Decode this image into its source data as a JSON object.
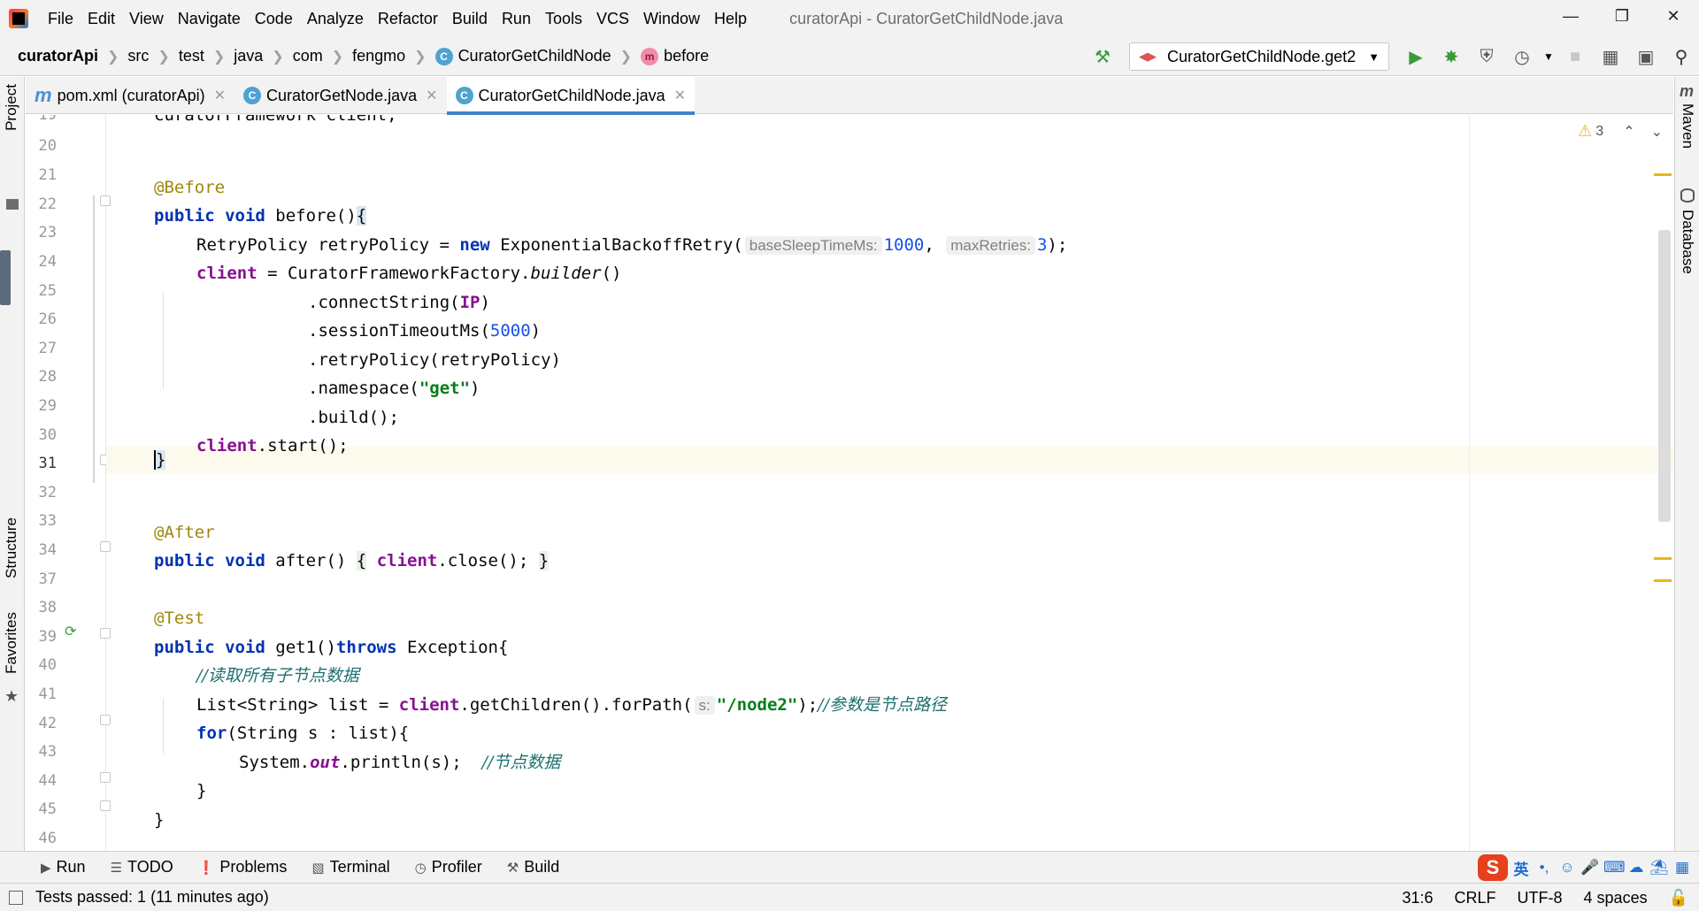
{
  "menubar": {
    "items": [
      "File",
      "Edit",
      "View",
      "Navigate",
      "Code",
      "Analyze",
      "Refactor",
      "Build",
      "Run",
      "Tools",
      "VCS",
      "Window",
      "Help"
    ],
    "window_title": "curatorApi - CuratorGetChildNode.java"
  },
  "navbar": {
    "project": "curatorApi",
    "crumbs": [
      "src",
      "test",
      "java",
      "com",
      "fengmo"
    ],
    "class_crumb": "CuratorGetChildNode",
    "method_crumb": "before",
    "run_config": "CuratorGetChildNode.get2"
  },
  "left_strip": {
    "project": "Project",
    "structure": "Structure",
    "favorites": "Favorites"
  },
  "right_strip": {
    "maven": "Maven",
    "database": "Database"
  },
  "tabs": [
    {
      "label": "pom.xml (curatorApi)",
      "icon": "maven-icon"
    },
    {
      "label": "CuratorGetNode.java",
      "icon": "class-icon"
    },
    {
      "label": "CuratorGetChildNode.java",
      "icon": "class-icon"
    }
  ],
  "inspection": {
    "warnings": "3"
  },
  "line_numbers": [
    "19",
    "20",
    "21",
    "22",
    "23",
    "24",
    "25",
    "26",
    "27",
    "28",
    "29",
    "30",
    "31",
    "32",
    "33",
    "34",
    "37",
    "38",
    "39",
    "40",
    "41",
    "42",
    "43",
    "44",
    "45",
    "46"
  ],
  "code": {
    "l19": "curatorFramework client;",
    "l21": "@Before",
    "l22_kw": "public void",
    "l22_rest": " before()",
    "l22_brace": "{",
    "l23_a": "RetryPolicy retryPolicy = ",
    "l23_new": "new",
    "l23_b": " ExponentialBackoffRetry(",
    "l23_hint1": "baseSleepTimeMs:",
    "l23_n1": "1000",
    "l23_c": ", ",
    "l23_hint2": "maxRetries:",
    "l23_n2": "3",
    "l23_d": ");",
    "l24_fld": "client",
    "l24_a": " = CuratorFrameworkFactory.",
    "l24_it": "builder",
    "l24_b": "()",
    "l25_a": ".connectString(",
    "l25_fld": "IP",
    "l25_b": ")",
    "l26_a": ".sessionTimeoutMs(",
    "l26_n": "5000",
    "l26_b": ")",
    "l27": ".retryPolicy(retryPolicy)",
    "l28_a": ".namespace(",
    "l28_s": "\"get\"",
    "l28_b": ")",
    "l29": ".build();",
    "l30_fld": "client",
    "l30_rest": ".start();",
    "l31": "}",
    "l33": "@After",
    "l34_kw": "public void",
    "l34_a": " after() ",
    "l34_o": "{",
    "l34_fld": "client",
    "l34_b": ".close(); ",
    "l34_c": "}",
    "l38": "@Test",
    "l39_kw1": "public void",
    "l39_a": " get1()",
    "l39_kw2": "throws",
    "l39_b": " Exception{",
    "l40": "//读取所有子节点数据",
    "l41_a": "List<String> list = ",
    "l41_fld": "client",
    "l41_b": ".getChildren().forPath(",
    "l41_hint": "s:",
    "l41_s": "\"/node2\"",
    "l41_c": ");",
    "l41_cmt": "//参数是节点路径",
    "l42_kw": "for",
    "l42_rest": "(String s : list){",
    "l43_a": "System.",
    "l43_fld": "out",
    "l43_b": ".println(s);  ",
    "l43_cmt": "//节点数据",
    "l44": "}",
    "l45": "}"
  },
  "toolwindows": [
    "Run",
    "TODO",
    "Problems",
    "Terminal",
    "Profiler",
    "Build"
  ],
  "ime": {
    "lang": "英",
    "punct": "•,"
  },
  "statusbar": {
    "message": "Tests passed: 1 (11 minutes ago)",
    "position": "31:6",
    "line_sep": "CRLF",
    "encoding": "UTF-8",
    "indent": "4 spaces"
  }
}
